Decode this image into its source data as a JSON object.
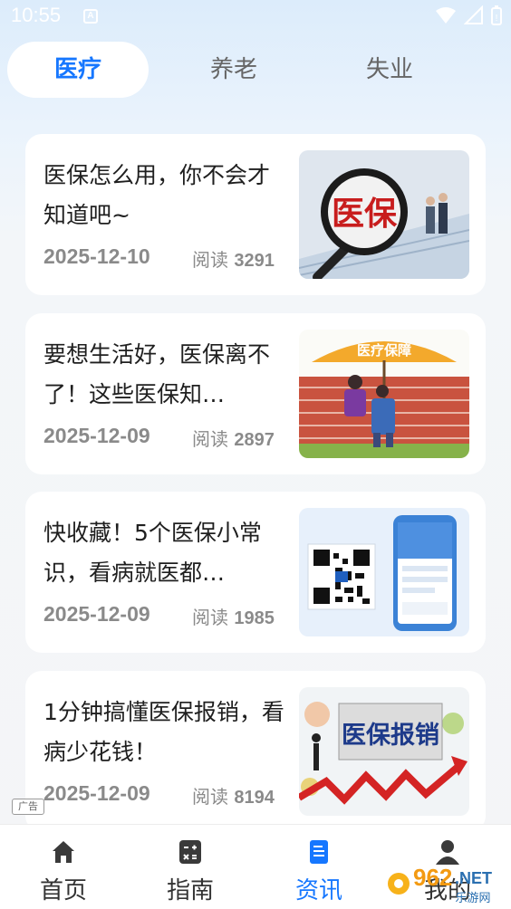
{
  "status_bar": {
    "time": "10:55",
    "notif_badge": "A"
  },
  "tabs": [
    {
      "label": "医疗",
      "active": true
    },
    {
      "label": "养老",
      "active": false
    },
    {
      "label": "失业",
      "active": false
    }
  ],
  "articles": [
    {
      "title": "医保怎么用，你不会才知道吧~",
      "date": "2025-12-10",
      "read_label": "阅读",
      "read_count": "3291",
      "image_text": "医保"
    },
    {
      "title": "要想生活好，医保离不了！这些医保知…",
      "date": "2025-12-09",
      "read_label": "阅读",
      "read_count": "2897",
      "image_text": "医疗保障"
    },
    {
      "title": "快收藏！5个医保小常识，看病就医都…",
      "date": "2025-12-09",
      "read_label": "阅读",
      "read_count": "1985",
      "image_text": ""
    },
    {
      "title": "1分钟搞懂医保报销，看病少花钱！",
      "date": "2025-12-09",
      "read_label": "阅读",
      "read_count": "8194",
      "image_text": "医保报销"
    }
  ],
  "ad_badge": "广告",
  "bottom_nav": [
    {
      "label": "首页",
      "icon": "home-icon",
      "active": false
    },
    {
      "label": "指南",
      "icon": "calculator-icon",
      "active": false
    },
    {
      "label": "资讯",
      "icon": "document-icon",
      "active": true
    },
    {
      "label": "我的",
      "icon": "user-icon",
      "active": false
    }
  ],
  "watermark": {
    "number": "962",
    "suffix": ".NET",
    "subtitle": "乐游网"
  },
  "colors": {
    "accent": "#1677ff",
    "date_gray": "#8a8a8a"
  }
}
